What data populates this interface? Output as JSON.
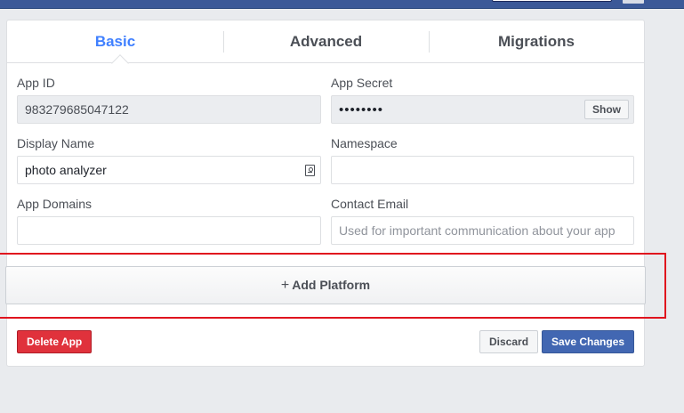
{
  "tabs": [
    {
      "label": "Basic",
      "active": true
    },
    {
      "label": "Advanced",
      "active": false
    },
    {
      "label": "Migrations",
      "active": false
    }
  ],
  "fields": {
    "app_id": {
      "label": "App ID",
      "value": "983279685047122"
    },
    "app_secret": {
      "label": "App Secret",
      "value": "••••••••",
      "show_label": "Show"
    },
    "display_name": {
      "label": "Display Name",
      "value": "photo analyzer",
      "icon": "contact-card-icon"
    },
    "namespace": {
      "label": "Namespace",
      "value": ""
    },
    "app_domains": {
      "label": "App Domains",
      "value": ""
    },
    "contact_email": {
      "label": "Contact Email",
      "placeholder": "Used for important communication about your app"
    }
  },
  "add_platform": {
    "plus": "+",
    "label": "Add Platform"
  },
  "actions": {
    "delete": "Delete App",
    "discard": "Discard",
    "save": "Save Changes"
  },
  "colors": {
    "accent": "#4080ff",
    "header": "#3b5998",
    "danger": "#e0323c",
    "primary": "#4267b2",
    "highlight": "#e0141e"
  }
}
